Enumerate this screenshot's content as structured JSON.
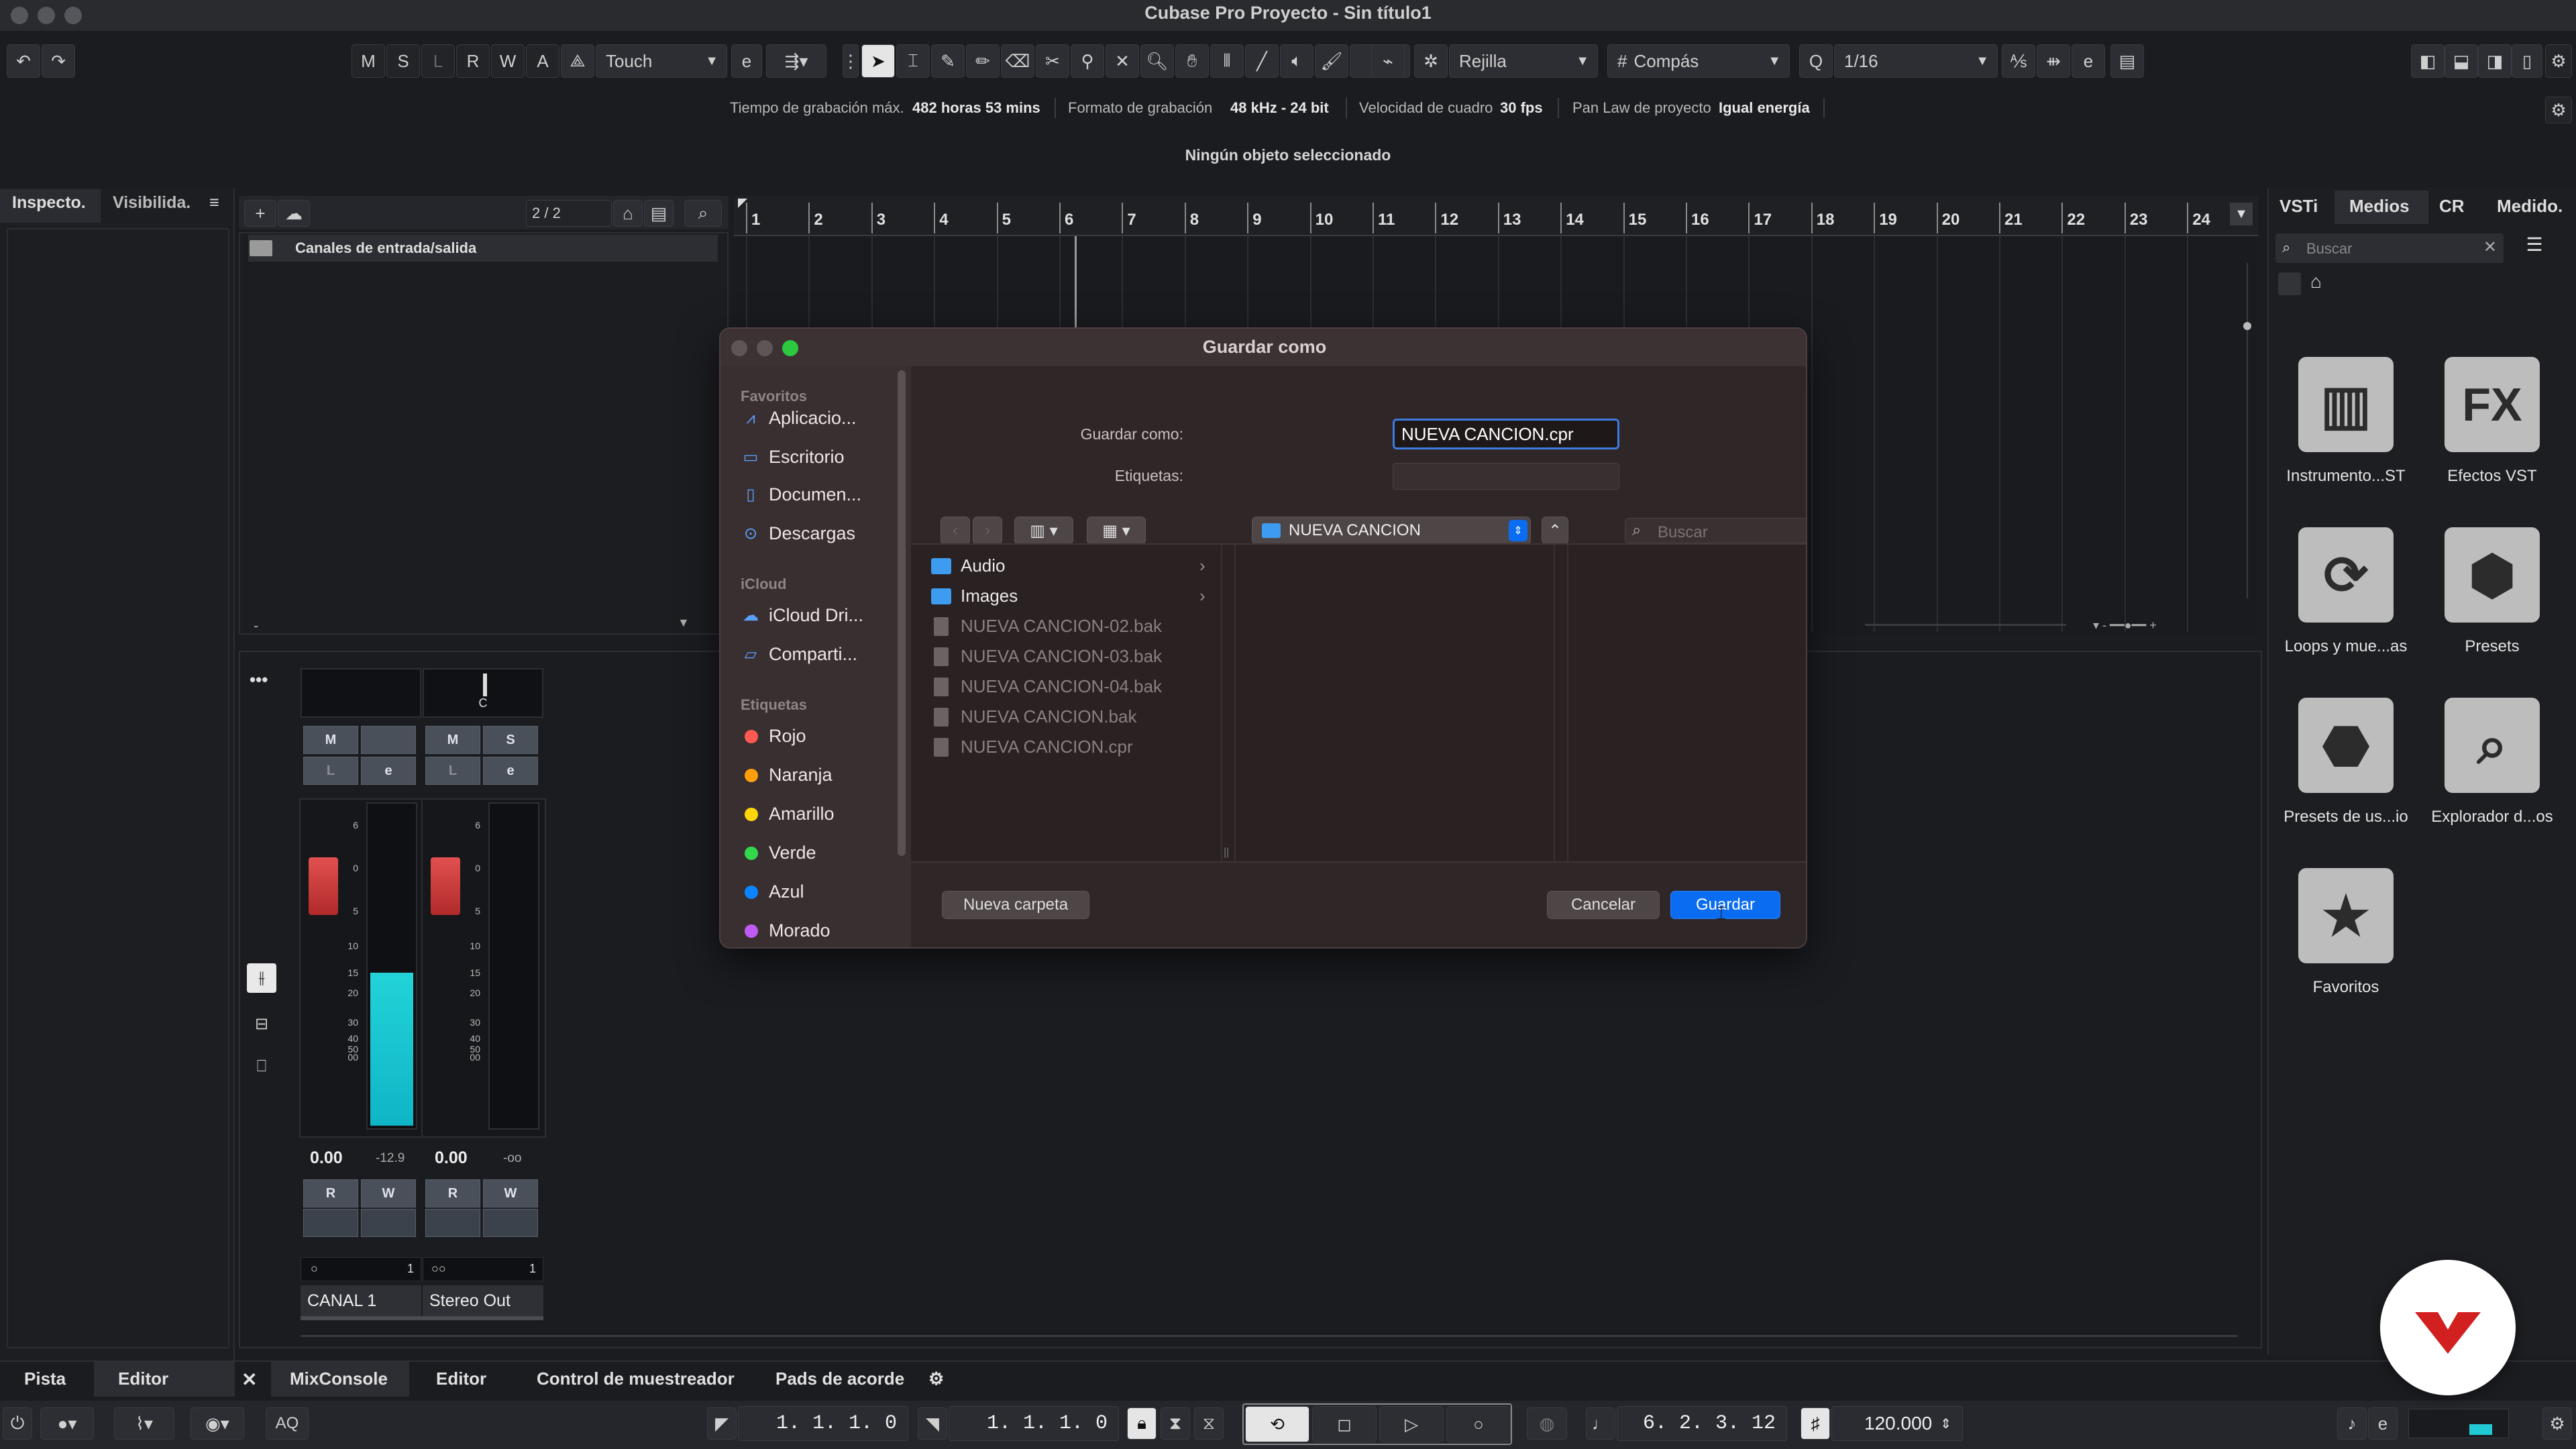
{
  "app": {
    "title": "Cubase Pro Proyecto - Sin título1"
  },
  "toolbar": {
    "mode_buttons": [
      "M",
      "S",
      "L",
      "R",
      "W",
      "A"
    ],
    "automation_mode": "Touch",
    "snap_type": "Rejilla",
    "grid_type": "Compás",
    "quantize": "1/16"
  },
  "infoline": {
    "rec_time_label": "Tiempo de grabación máx.",
    "rec_time_value": "482 horas 53 mins",
    "rec_format_label": "Formato de grabación",
    "rec_format_value": "48 kHz - 24 bit",
    "frame_rate_label": "Velocidad de cuadro",
    "frame_rate_value": "30 fps",
    "pan_law_label": "Pan Law de proyecto",
    "pan_law_value": "Igual energía"
  },
  "status": {
    "selection": "Ningún objeto seleccionado"
  },
  "left_zone": {
    "tab_inspector": "Inspecto.",
    "tab_visibility": "Visibilida."
  },
  "tracks": {
    "count": "2 / 2",
    "folder_name": "Canales de entrada/salida"
  },
  "ruler": {
    "bars": [
      "1",
      "2",
      "3",
      "4",
      "5",
      "6",
      "7",
      "8",
      "9",
      "10",
      "11",
      "12",
      "13",
      "14",
      "15",
      "16",
      "17",
      "18",
      "19",
      "20",
      "21",
      "22",
      "23",
      "24"
    ]
  },
  "mixer": {
    "pan_center": "C",
    "ch1": {
      "name": "CANAL 1",
      "volume": "0.00",
      "peak": "-12.9",
      "number": "1"
    },
    "ch2": {
      "name": "Stereo Out",
      "volume": "0.00",
      "peak": "-oo",
      "number": "1"
    },
    "scale": [
      "6",
      "0",
      "5",
      "10",
      "15",
      "20",
      "30",
      "40",
      "50",
      "00"
    ],
    "btn_m": "M",
    "btn_s": "S",
    "btn_l": "L",
    "btn_e": "e",
    "btn_r": "R",
    "btn_w": "W"
  },
  "bottom_tabs": {
    "pista": "Pista",
    "editor_left": "Editor",
    "mixconsole": "MixConsole",
    "editor": "Editor",
    "sampler": "Control de muestreador",
    "chord_pads": "Pads de acorde"
  },
  "transport": {
    "left_locator": "1. 1. 1.   0",
    "right_locator": "1. 1. 1.   0",
    "position": "6. 2. 3.  12",
    "tempo": "120.000",
    "aq": "AQ"
  },
  "right_zone": {
    "tabs": [
      "VSTi",
      "Medios",
      "CR",
      "Medido."
    ],
    "search_placeholder": "Buscar",
    "tiles": [
      {
        "label": "Instrumento...ST",
        "icon": "piano-icon"
      },
      {
        "label": "Efectos VST",
        "icon": "fx-icon"
      },
      {
        "label": "Loops y mue...as",
        "icon": "loop-icon"
      },
      {
        "label": "Presets",
        "icon": "presets-icon"
      },
      {
        "label": "Presets de us...io",
        "icon": "user-presets-icon"
      },
      {
        "label": "Explorador d...os",
        "icon": "file-browser-icon"
      },
      {
        "label": "Favoritos",
        "icon": "star-icon"
      }
    ]
  },
  "dialog": {
    "title": "Guardar como",
    "save_as_label": "Guardar como:",
    "filename": "NUEVA CANCION.cpr",
    "tags_label": "Etiquetas:",
    "location": "NUEVA CANCION",
    "search_placeholder": "Buscar",
    "sidebar": {
      "favorites_header": "Favoritos",
      "favorites": [
        "Aplicacio...",
        "Escritorio",
        "Documen...",
        "Descargas"
      ],
      "icloud_header": "iCloud",
      "icloud": [
        "iCloud Dri...",
        "Comparti..."
      ],
      "tags_header": "Etiquetas",
      "tags": [
        {
          "name": "Rojo",
          "color": "#ff5a52"
        },
        {
          "name": "Naranja",
          "color": "#ff9f0a"
        },
        {
          "name": "Amarillo",
          "color": "#ffd60a"
        },
        {
          "name": "Verde",
          "color": "#32d74b"
        },
        {
          "name": "Azul",
          "color": "#0a84ff"
        },
        {
          "name": "Morado",
          "color": "#bf5af2"
        }
      ]
    },
    "files": [
      {
        "name": "Audio",
        "kind": "folder"
      },
      {
        "name": "Images",
        "kind": "folder"
      },
      {
        "name": "NUEVA CANCION-02.bak",
        "kind": "file"
      },
      {
        "name": "NUEVA CANCION-03.bak",
        "kind": "file"
      },
      {
        "name": "NUEVA CANCION-04.bak",
        "kind": "file"
      },
      {
        "name": "NUEVA CANCION.bak",
        "kind": "file"
      },
      {
        "name": "NUEVA CANCION.cpr",
        "kind": "file"
      }
    ],
    "new_folder_button": "Nueva carpeta",
    "cancel_button": "Cancelar",
    "save_button": "Guardar",
    "accent_color": "#0a6cf0"
  }
}
